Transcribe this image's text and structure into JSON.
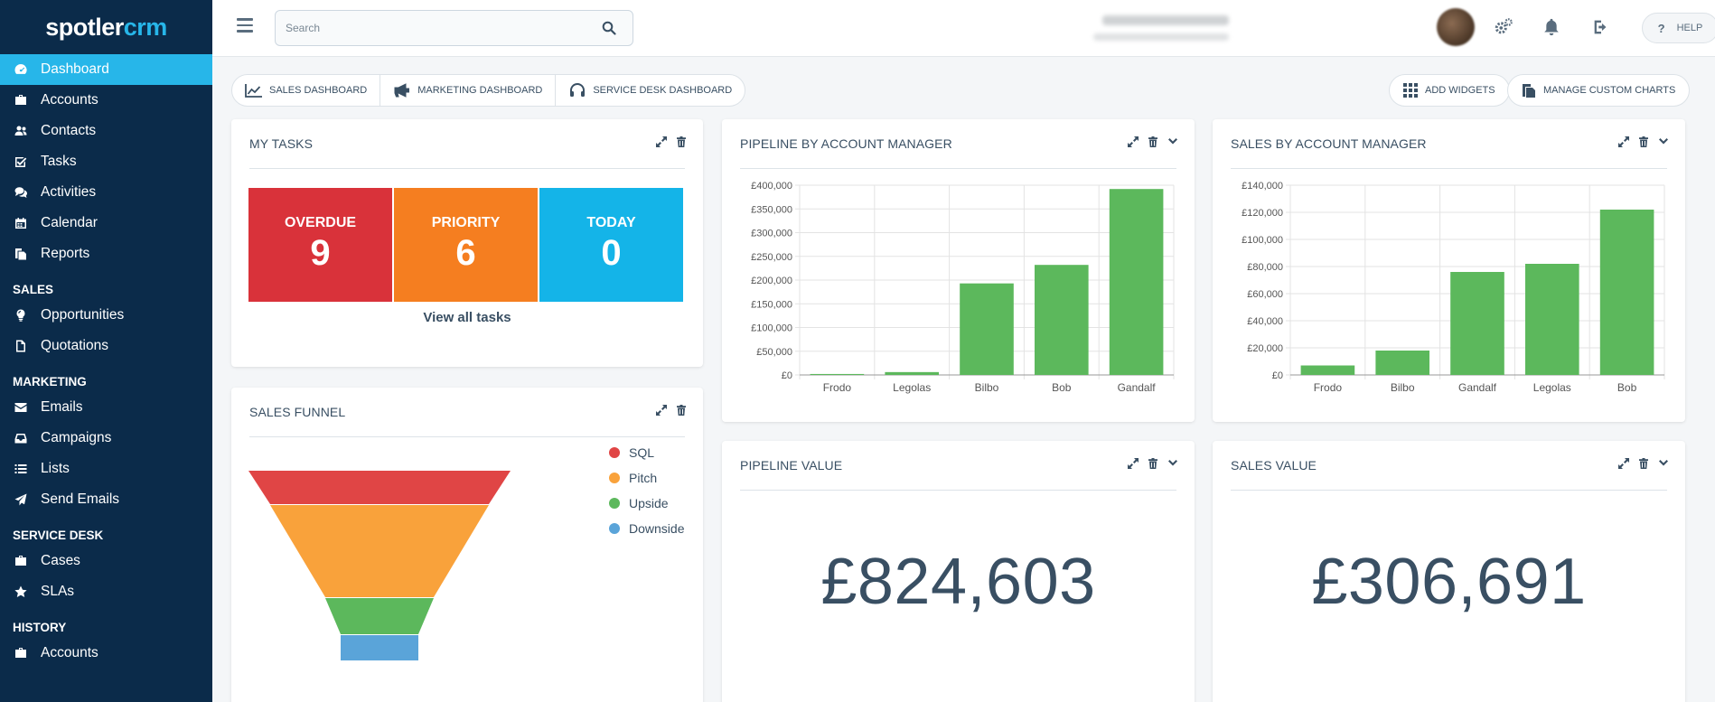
{
  "app": {
    "logo_main": "spotler",
    "logo_accent": "crm"
  },
  "sidebar": {
    "items": [
      {
        "label": "Dashboard",
        "icon": "dashboard-icon",
        "active": true
      },
      {
        "label": "Accounts",
        "icon": "briefcase-icon"
      },
      {
        "label": "Contacts",
        "icon": "users-icon"
      },
      {
        "label": "Tasks",
        "icon": "check-square-icon"
      },
      {
        "label": "Activities",
        "icon": "comments-icon"
      },
      {
        "label": "Calendar",
        "icon": "calendar-icon"
      },
      {
        "label": "Reports",
        "icon": "copy-icon"
      }
    ],
    "sales_header": "SALES",
    "sales_items": [
      {
        "label": "Opportunities",
        "icon": "lightbulb-icon"
      },
      {
        "label": "Quotations",
        "icon": "file-icon"
      }
    ],
    "marketing_header": "MARKETING",
    "marketing_items": [
      {
        "label": "Emails",
        "icon": "envelope-icon"
      },
      {
        "label": "Campaigns",
        "icon": "inbox-icon"
      },
      {
        "label": "Lists",
        "icon": "list-icon"
      },
      {
        "label": "Send Emails",
        "icon": "paper-plane-icon"
      }
    ],
    "service_header": "SERVICE DESK",
    "service_items": [
      {
        "label": "Cases",
        "icon": "briefcase-icon"
      },
      {
        "label": "SLAs",
        "icon": "star-icon"
      }
    ],
    "history_header": "HISTORY",
    "history_items": [
      {
        "label": "Accounts",
        "icon": "briefcase-icon"
      }
    ]
  },
  "topbar": {
    "search_placeholder": "Search",
    "help_label": "HELP"
  },
  "tabs": [
    {
      "label": "SALES DASHBOARD",
      "icon": "line-chart-icon"
    },
    {
      "label": "MARKETING DASHBOARD",
      "icon": "bullhorn-icon"
    },
    {
      "label": "SERVICE DESK DASHBOARD",
      "icon": "headset-icon"
    }
  ],
  "actions": {
    "add_widgets": "ADD WIDGETS",
    "manage_charts": "MANAGE CUSTOM CHARTS"
  },
  "colors": {
    "sidebar": "#0b2b4a",
    "accent": "#27b6e9",
    "bar": "#5cb85c",
    "overdue": "#d9323a",
    "priority": "#f57e20",
    "today": "#14b4e8"
  },
  "my_tasks": {
    "title": "MY TASKS",
    "tiles": [
      {
        "label": "OVERDUE",
        "value": "9"
      },
      {
        "label": "PRIORITY",
        "value": "6"
      },
      {
        "label": "TODAY",
        "value": "0"
      }
    ],
    "view_all": "View all tasks"
  },
  "sales_funnel": {
    "title": "SALES FUNNEL",
    "legend": [
      {
        "label": "SQL",
        "color": "#e04545"
      },
      {
        "label": "Pitch",
        "color": "#f9a23b"
      },
      {
        "label": "Upside",
        "color": "#5cb85c"
      },
      {
        "label": "Downside",
        "color": "#5aa4d9"
      }
    ]
  },
  "pipeline_value": {
    "title": "PIPELINE VALUE",
    "value": "£824,603"
  },
  "sales_value": {
    "title": "SALES VALUE",
    "value": "£306,691"
  },
  "chart_data": [
    {
      "type": "bar",
      "title": "PIPELINE BY ACCOUNT MANAGER",
      "categories": [
        "Frodo",
        "Legolas",
        "Bilbo",
        "Bob",
        "Gandalf"
      ],
      "values": [
        2000,
        6000,
        193000,
        232000,
        392000
      ],
      "ylim": [
        0,
        400000
      ],
      "yticks": [
        "£0",
        "£50,000",
        "£100,000",
        "£150,000",
        "£200,000",
        "£250,000",
        "£300,000",
        "£350,000",
        "£400,000"
      ],
      "grid": true
    },
    {
      "type": "bar",
      "title": "SALES BY ACCOUNT MANAGER",
      "categories": [
        "Frodo",
        "Bilbo",
        "Gandalf",
        "Legolas",
        "Bob"
      ],
      "values": [
        7000,
        18000,
        76000,
        82000,
        122000
      ],
      "ylim": [
        0,
        140000
      ],
      "yticks": [
        "£0",
        "£20,000",
        "£40,000",
        "£60,000",
        "£80,000",
        "£100,000",
        "£120,000",
        "£140,000"
      ],
      "grid": true
    }
  ]
}
